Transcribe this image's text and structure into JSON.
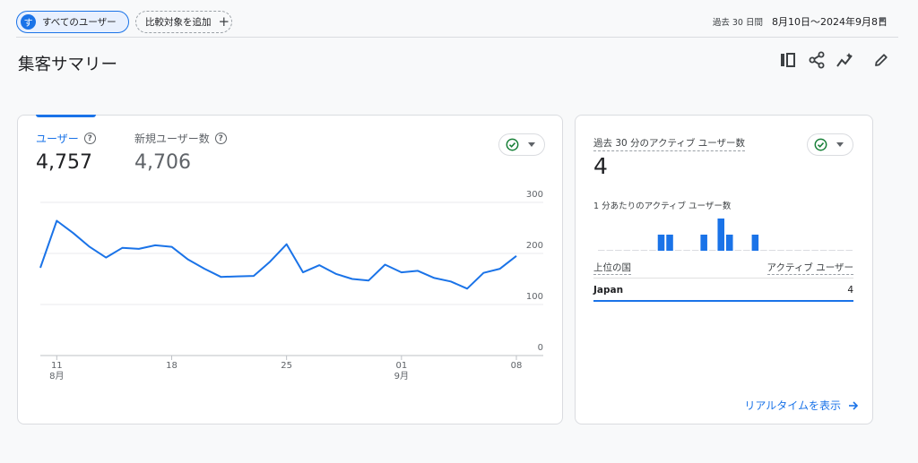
{
  "topbar": {
    "segment_avatar": "す",
    "segment_label": "すべてのユーザー",
    "add_comparison_label": "比較対象を追加",
    "add_icon": "plus-icon",
    "date_prefix": "過去 30 日間",
    "date_range": "8月10日～2024年9月8日"
  },
  "page": {
    "title": "集客サマリー"
  },
  "toolbar": {
    "icons": [
      "compare-columns-icon",
      "share-icon",
      "insights-icon",
      "edit-icon"
    ]
  },
  "main_card": {
    "metric1": {
      "label": "ユーザー",
      "value": "4,757"
    },
    "metric2": {
      "label": "新規ユーザー数",
      "value": "4,706"
    },
    "help_icon": "?"
  },
  "realtime_card": {
    "label": "過去 30 分のアクティブ ユーザー数",
    "value": "4",
    "per_minute_label": "1 分あたりのアクティブ ユーザー数",
    "table_header_left": "上位の国",
    "table_header_right": "アクティブ ユーザー",
    "rows": [
      {
        "country": "Japan",
        "count": "4"
      }
    ],
    "link_label": "リアルタイムを表示"
  },
  "colors": {
    "accent": "#1a73e8",
    "check": "#188038"
  },
  "chart_data": [
    {
      "type": "line",
      "x_tick_labels": [
        "11",
        "18",
        "25",
        "01",
        "08"
      ],
      "x_month_labels": [
        "8月",
        "",
        "",
        "9月",
        ""
      ],
      "y_ticks": [
        0,
        100,
        200,
        300
      ],
      "ylim": [
        0,
        300
      ],
      "grid": true,
      "series": [
        {
          "values": [
            172,
            264,
            240,
            213,
            192,
            211,
            209,
            216,
            213,
            188,
            170,
            154,
            155,
            156,
            184,
            218,
            163,
            177,
            160,
            150,
            147,
            178,
            163,
            166,
            152,
            145,
            131,
            162,
            170,
            195
          ]
        }
      ]
    },
    {
      "type": "bar",
      "values": [
        0,
        0,
        0,
        0,
        0,
        0,
        0,
        1,
        1,
        0,
        0,
        0,
        1,
        0,
        2,
        1,
        0,
        0,
        1,
        0,
        0,
        0,
        0,
        0,
        0,
        0,
        0,
        0,
        0,
        0
      ]
    }
  ]
}
